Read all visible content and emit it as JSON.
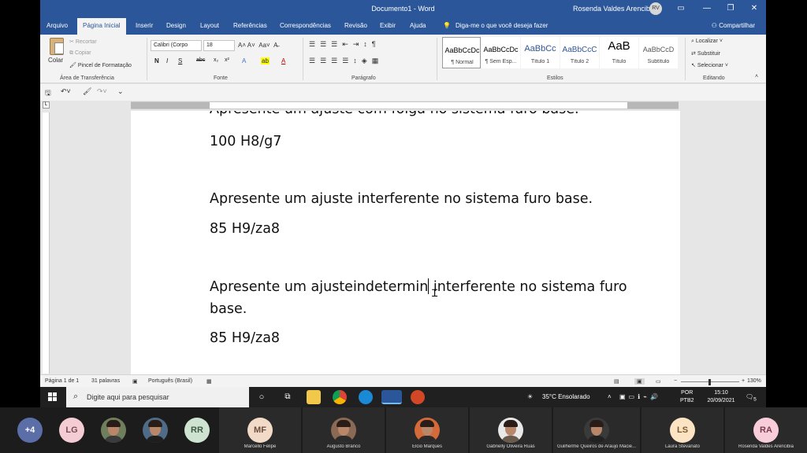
{
  "window": {
    "doc_title": "Documento1  -  Word",
    "user_name": "Rosenda Valdes Arencibia",
    "user_initials": "RV"
  },
  "tabs": [
    {
      "label": "Arquivo"
    },
    {
      "label": "Página Inicial"
    },
    {
      "label": "Inserir"
    },
    {
      "label": "Design"
    },
    {
      "label": "Layout"
    },
    {
      "label": "Referências"
    },
    {
      "label": "Correspondências"
    },
    {
      "label": "Revisão"
    },
    {
      "label": "Exibir"
    },
    {
      "label": "Ajuda"
    }
  ],
  "tell_me": "Diga-me o que você deseja fazer",
  "share": "Compartilhar",
  "ribbon": {
    "clipboard": {
      "paste": "Colar",
      "cut": "Recortar",
      "copy": "Copiar",
      "format_painter": "Pincel de Formatação",
      "label": "Área de Transferência"
    },
    "font": {
      "name": "Calibri (Corpo",
      "size": "18",
      "label": "Fonte"
    },
    "paragraph": {
      "label": "Parágrafo"
    },
    "styles": {
      "label": "Estilos",
      "items": [
        {
          "preview": "AaBbCcDc",
          "name": "¶ Normal"
        },
        {
          "preview": "AaBbCcDc",
          "name": "¶ Sem Esp..."
        },
        {
          "preview": "AaBbCc",
          "name": "Título 1"
        },
        {
          "preview": "AaBbCcC",
          "name": "Título 2"
        },
        {
          "preview": "AaB",
          "name": "Título"
        },
        {
          "preview": "AaBbCcD",
          "name": "Subtítulo"
        }
      ]
    },
    "editing": {
      "find": "Localizar",
      "replace": "Substituir",
      "select": "Selecionar",
      "label": "Editando"
    }
  },
  "document": {
    "partial_line": "Apresente um ajuste com folga no sistema furo base.",
    "line1": "100 H8/g7",
    "line2": "Apresente um ajuste interferente no sistema furo base.",
    "line3": "85 H9/za8",
    "line4_before_caret": "Apresente um ajusteindetermin",
    "line4_after_caret": " interferente no sistema furo base.",
    "line5": "85 H9/za8"
  },
  "status": {
    "page": "Página 1 de 1",
    "words": "31 palavras",
    "language": "Português (Brasil)",
    "zoom": "130%"
  },
  "taskbar": {
    "search_placeholder": "Digite aqui para pesquisar",
    "weather": "35°C  Ensolarado",
    "lang": "POR",
    "lang2": "PTB2",
    "time": "15:10",
    "date": "20/09/2021",
    "notif": "5"
  },
  "meet": {
    "more": "+4",
    "participants": [
      {
        "initials": "LG",
        "name": ""
      },
      {
        "initials": "",
        "name": ""
      },
      {
        "initials": "",
        "name": ""
      },
      {
        "initials": "RR",
        "name": ""
      },
      {
        "initials": "MF",
        "name": "Marcello Felipe"
      },
      {
        "initials": "",
        "name": "Augusto Branco"
      },
      {
        "initials": "",
        "name": "Elcio Marques"
      },
      {
        "initials": "",
        "name": "Gabrielly Oliveira Ruas"
      },
      {
        "initials": "",
        "name": "Guilherme Queiros de Araujo Macie..."
      },
      {
        "initials": "LS",
        "name": "Laura Stevanato"
      },
      {
        "initials": "RA",
        "name": "Rosenda Valdes Arencibia"
      }
    ]
  }
}
